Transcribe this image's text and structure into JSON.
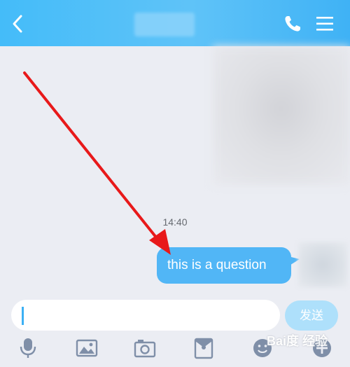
{
  "header": {
    "back_icon": "back-chevron-icon",
    "call_icon": "phone-icon",
    "menu_icon": "hamburger-menu-icon",
    "background": "#4ab9f8"
  },
  "chat": {
    "timestamp": "14:40",
    "message_text": "this is a question",
    "bubble_color": "#51b6f6"
  },
  "input": {
    "placeholder": "",
    "value": "",
    "send_label": "发送"
  },
  "toolbar": {
    "icons": [
      "microphone-icon",
      "image-icon",
      "camera-icon",
      "red-packet-icon",
      "emoji-icon",
      "plus-icon"
    ]
  },
  "watermark": "Bai度 经验"
}
